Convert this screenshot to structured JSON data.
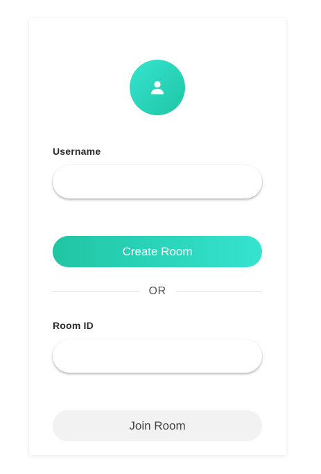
{
  "form": {
    "username_label": "Username",
    "username_value": "",
    "username_placeholder": "",
    "create_button": "Create Room",
    "divider_text": "OR",
    "roomid_label": "Room ID",
    "roomid_value": "",
    "roomid_placeholder": "",
    "join_button": "Join Room"
  },
  "icons": {
    "avatar": "user-icon"
  },
  "colors": {
    "accent_start": "#1fc6a4",
    "accent_end": "#35e3cf",
    "secondary_button": "#f2f2f2"
  }
}
